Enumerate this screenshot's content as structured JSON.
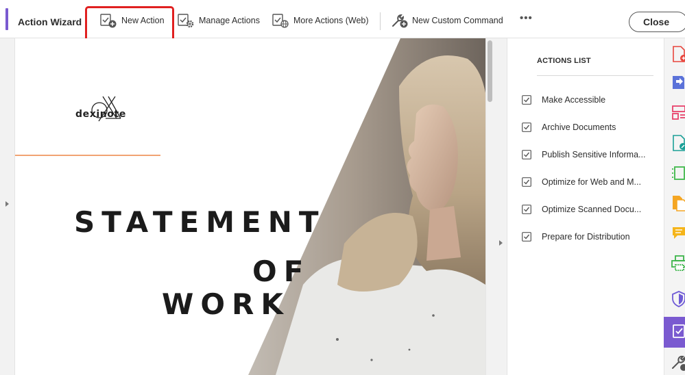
{
  "toolbar": {
    "title": "Action Wizard",
    "buttons": [
      {
        "label": "New Action",
        "icon": "new-action-icon"
      },
      {
        "label": "Manage Actions",
        "icon": "manage-actions-icon"
      },
      {
        "label": "More Actions (Web)",
        "icon": "more-actions-web-icon"
      },
      {
        "label": "New Custom Command",
        "icon": "wrench-plus-icon"
      }
    ],
    "more": "•••",
    "close": "Close",
    "accent_color": "#7a5ad0",
    "highlight_color": "#e02020"
  },
  "document": {
    "logo_text": "dexinote",
    "heading_line1": "STATEMENT",
    "heading_line2": "OF",
    "heading_line3": "WORK"
  },
  "actions_panel": {
    "title": "ACTIONS LIST",
    "items": [
      {
        "label": "Make Accessible"
      },
      {
        "label": "Archive Documents"
      },
      {
        "label": "Publish Sensitive Informa..."
      },
      {
        "label": "Optimize for Web and M..."
      },
      {
        "label": "Optimize Scanned Docu..."
      },
      {
        "label": "Prepare for Distribution"
      }
    ]
  },
  "tool_rail": {
    "icons": [
      "create-pdf-icon",
      "export-pdf-icon",
      "organize-pages-icon",
      "edit-pdf-icon",
      "compress-pdf-icon",
      "combine-files-icon",
      "comment-icon",
      "print-production-icon",
      "protect-icon",
      "action-wizard-icon",
      "more-tools-icon"
    ],
    "active": "action-wizard-icon"
  }
}
